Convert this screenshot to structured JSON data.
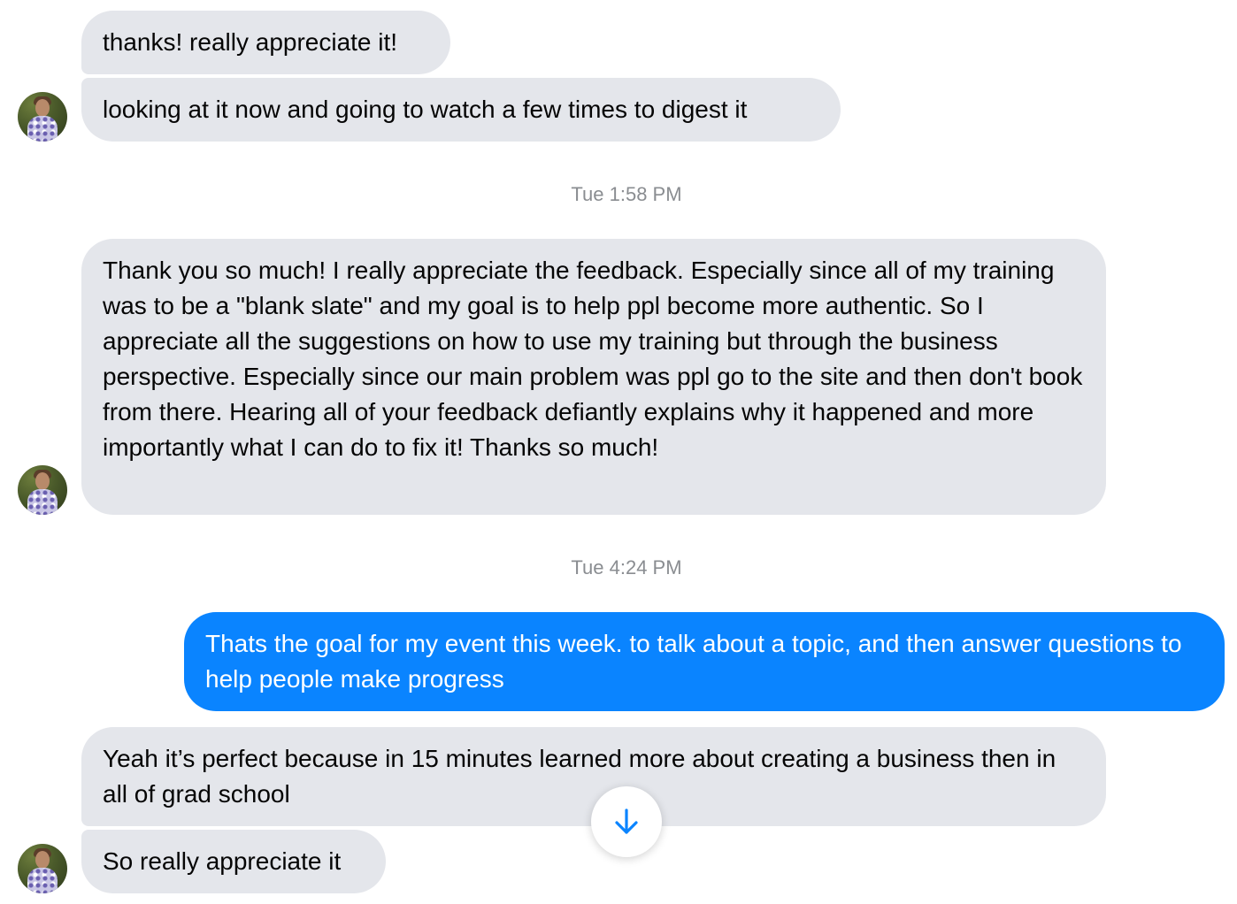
{
  "messages": [
    {
      "sender": "other",
      "text": "thanks! really appreciate it!"
    },
    {
      "sender": "other",
      "text": "looking at it now and going to watch a few times to digest it"
    },
    {
      "sender": "other",
      "text": "Thank you so much! I really appreciate the feedback. Especially since all of my training was to be a \"blank slate\" and my goal is to help ppl become more authentic. So I appreciate all the suggestions on how to use my training but through the business perspective. Especially since our main problem was ppl go to the site and then don't book from there. Hearing all of your feedback defiantly explains why it happened and more importantly what I can do to fix it! Thanks so much!"
    },
    {
      "sender": "me",
      "text": "Thats the goal for my event this week. to talk about a topic, and then answer questions to help people make progress"
    },
    {
      "sender": "other",
      "text": "Yeah it’s perfect because in 15 minutes learned more about creating a business then in all of grad school"
    },
    {
      "sender": "other",
      "text": "So really appreciate it"
    }
  ],
  "timestamps": [
    "Tue 1:58 PM",
    "Tue 4:24 PM"
  ],
  "icons": {
    "avatar": "contact-avatar",
    "scroll": "arrow-down-icon"
  },
  "colors": {
    "incoming_bubble": "#e4e6eb",
    "outgoing_bubble": "#0a84ff",
    "timestamp_text": "#8a8d91",
    "accent": "#0a84ff"
  }
}
